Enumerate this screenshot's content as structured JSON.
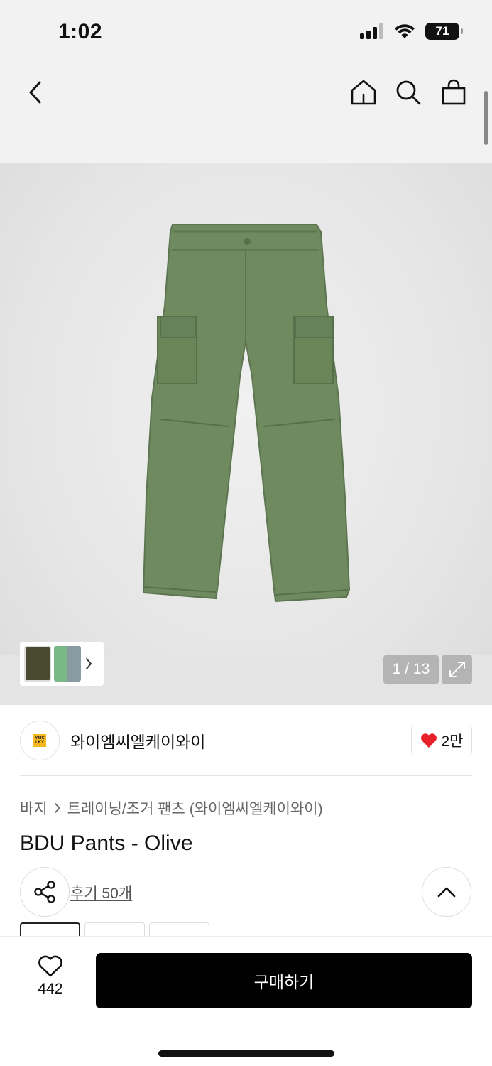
{
  "status_bar": {
    "time": "1:02",
    "battery": "71"
  },
  "nav": {
    "back_icon": "chevron-left-icon",
    "home_icon": "home-icon",
    "search_icon": "search-icon",
    "cart_icon": "shopping-bag-icon"
  },
  "gallery": {
    "counter": "1 / 13",
    "expand_icon": "expand-icon",
    "thumbs_next_icon": "chevron-right-icon"
  },
  "brand": {
    "name": "와이엠씨엘케이와이",
    "logo_text": "YMC LKY",
    "likes": "2만"
  },
  "breadcrumb": {
    "level1": "바지",
    "separator": ">",
    "level2": "트레이닝/조거 팬츠 (와이엠씨엘케이와이)"
  },
  "product": {
    "title": "BDU Pants - Olive",
    "review_link": "후기 50개"
  },
  "bottom_bar": {
    "wish_count": "442",
    "buy_label": "구매하기"
  },
  "colors": {
    "accent": "#000000",
    "heart": "#e8202a",
    "pants": "#6e8a5e"
  }
}
